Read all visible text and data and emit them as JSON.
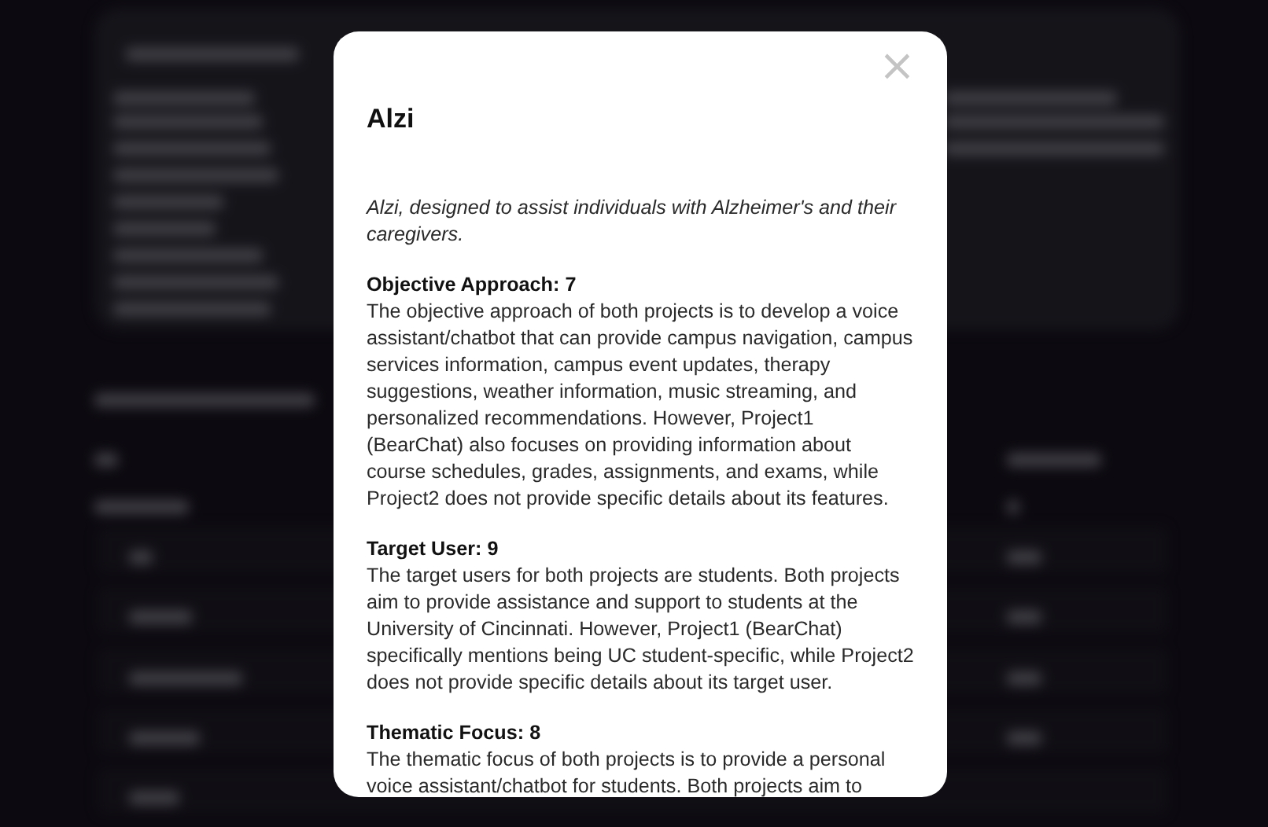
{
  "modal": {
    "title": "Alzi",
    "subtitle": "Alzi, designed to assist individuals with Alzheimer's and their caregivers.",
    "close": "×",
    "sections": [
      {
        "heading": "Objective Approach: 7",
        "body": "The objective approach of both projects is to develop a voice assistant/chatbot that can provide campus navigation, campus services information, campus event updates, therapy suggestions, weather information, music streaming, and personalized recommendations. However, Project1 (BearChat) also focuses on providing information about course schedules, grades, assignments, and exams, while Project2 does not provide specific details about its features."
      },
      {
        "heading": "Target User: 9",
        "body": "The target users for both projects are students. Both projects aim to provide assistance and support to students at the University of Cincinnati. However, Project1 (BearChat) specifically mentions being UC student-specific, while Project2 does not provide specific details about its target user."
      },
      {
        "heading": "Thematic Focus: 8",
        "body": "The thematic focus of both projects is to provide a personal voice assistant/chatbot for students. Both projects aim to"
      }
    ]
  }
}
